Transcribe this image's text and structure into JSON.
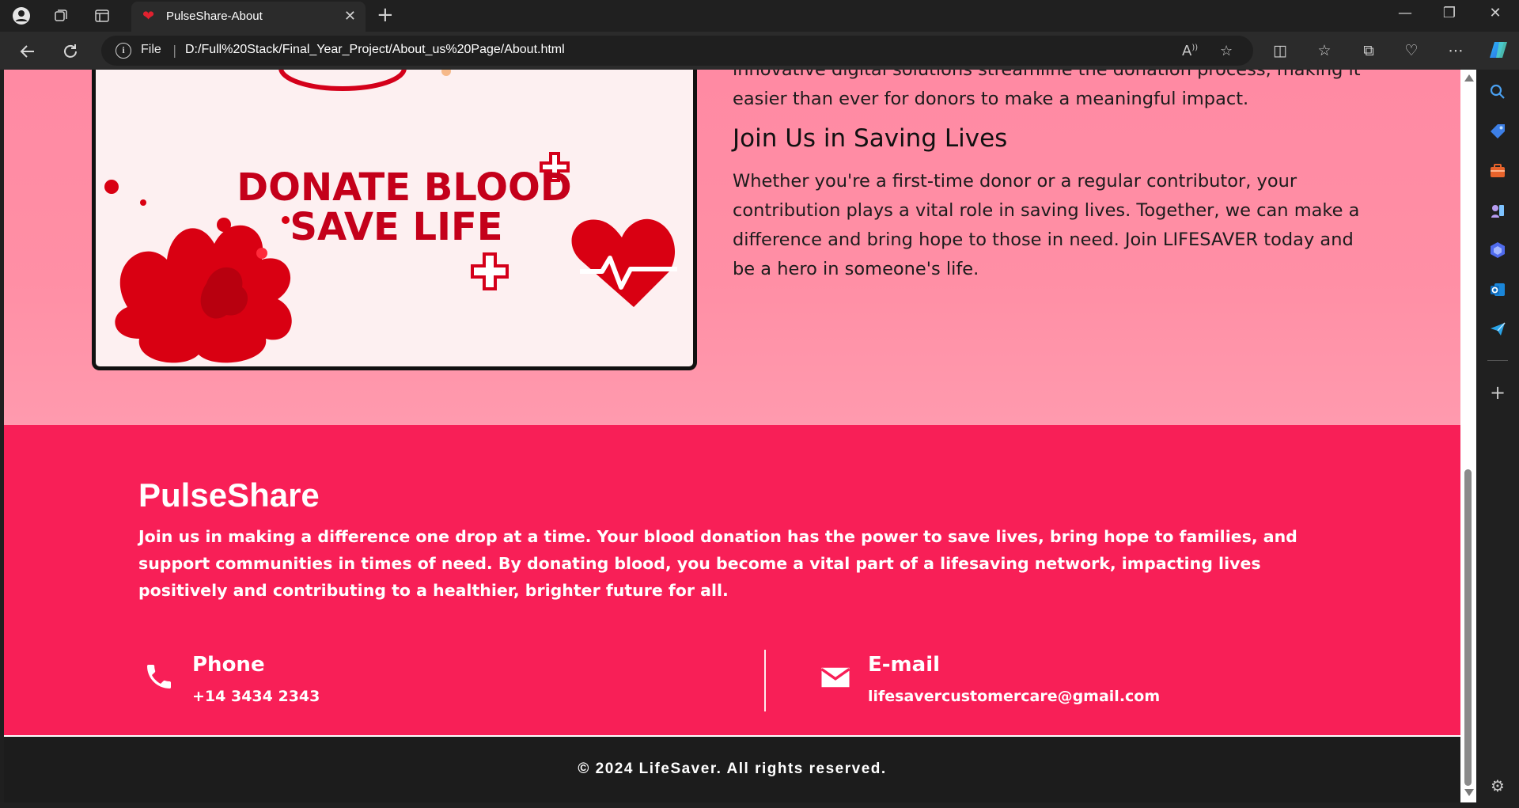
{
  "browser": {
    "tab_title": "PulseShare-About",
    "protocol_label": "File",
    "url": "D:/Full%20Stack/Final_Year_Project/About_us%20Page/About.html"
  },
  "image_card": {
    "line1": "DONATE BLOOD",
    "line2": "SAVE LIFE"
  },
  "about": {
    "intro_tail": "innovative digital solutions streamline the donation process, making it easier than ever for donors to make a meaningful impact.",
    "heading": "Join Us in Saving Lives",
    "body": "Whether you're a first-time donor or a regular contributor, your contribution plays a vital role in saving lives. Together, we can make a difference and bring hope to those in need. Join LIFESAVER today and be a hero in someone's life."
  },
  "footer": {
    "brand": "PulseShare",
    "tagline": "Join us in making a difference one drop at a time. Your blood donation has the power to save lives, bring hope to families, and support communities in times of need. By donating blood, you become a vital part of a lifesaving network, impacting lives positively and contributing to a healthier, brighter future for all.",
    "phone_label": "Phone",
    "phone_value": "+14 3434 2343",
    "email_label": "E-mail",
    "email_value": "lifesavercustomercare@gmail.com",
    "copyright": "© 2024 LifeSaver. All rights reserved."
  },
  "colors": {
    "hero_bg": "#ff8aa3",
    "footer_bg": "#f81f57",
    "footer_bottom_bg": "#1c1c1c",
    "accent_red": "#d4001a"
  },
  "icons": {
    "phone": "phone-icon",
    "email": "mail-icon"
  }
}
